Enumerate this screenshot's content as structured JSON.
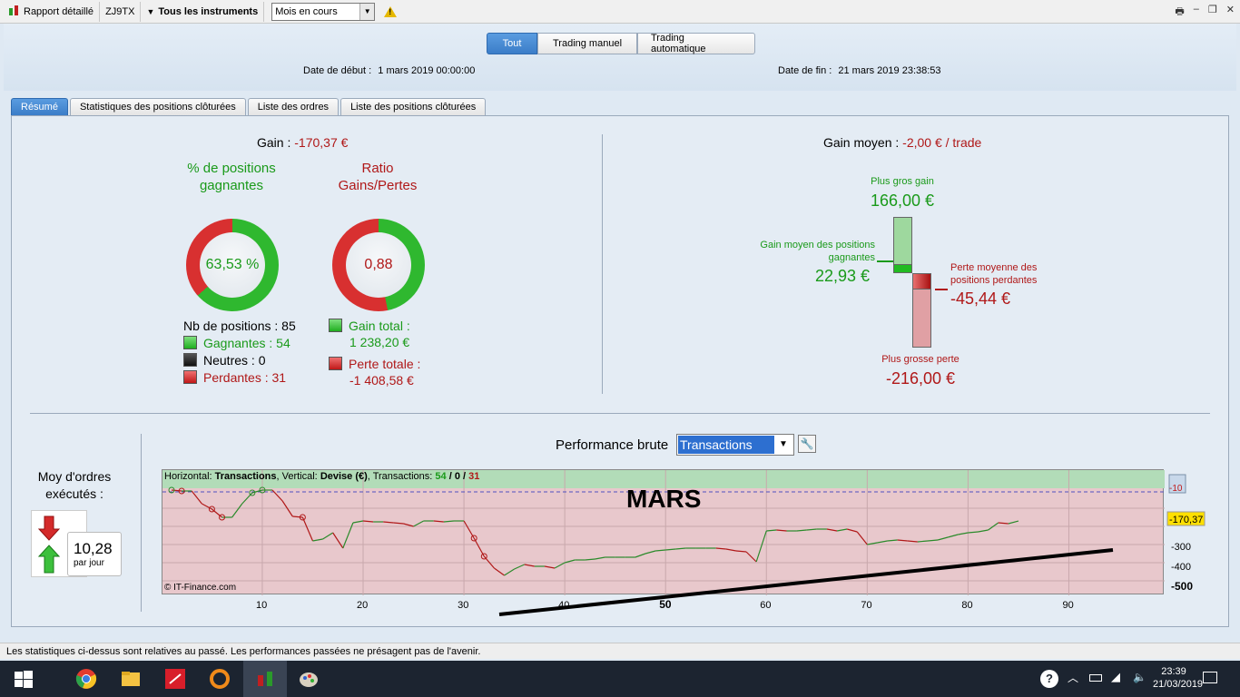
{
  "toolbar": {
    "report_label": "Rapport détaillé",
    "account": "ZJ9TX",
    "instruments": "Tous les instruments",
    "period_select": "Mois en cours"
  },
  "header": {
    "mode_tabs": [
      "Tout",
      "Trading manuel",
      "Trading automatique"
    ],
    "start_label": "Date de début :",
    "start_value": "1 mars 2019 00:00:00",
    "end_label": "Date de fin :",
    "end_value": "21 mars 2019 23:38:53"
  },
  "tabs": [
    "Résumé",
    "Statistiques des positions clôturées",
    "Liste des ordres",
    "Liste des positions clôturées"
  ],
  "summary": {
    "gain_label": "Gain :",
    "gain_value": "-170,37 €",
    "win_pct_title": "% de positions gagnantes",
    "win_pct_value": "63,53 %",
    "ratio_title": "Ratio Gains/Pertes",
    "ratio_value": "0,88",
    "nb_positions": "Nb de positions : 85",
    "winners": "Gagnantes : 54",
    "neutral": "Neutres : 0",
    "losers": "Perdantes : 31",
    "total_gain_label": "Gain total :",
    "total_gain_value": "1 238,20 €",
    "total_loss_label": "Perte totale :",
    "total_loss_value": "-1 408,58 €",
    "win_fraction": 0.6353,
    "ratio_fraction": 0.468
  },
  "avg_gain": {
    "label": "Gain moyen :",
    "value": "-2,00 € / trade",
    "biggest_gain_label": "Plus gros gain",
    "biggest_gain_value": "166,00 €",
    "avg_win_label": "Gain moyen des positions gagnantes",
    "avg_win_value": "22,93 €",
    "avg_loss_label": "Perte moyenne des positions perdantes",
    "avg_loss_value": "-45,44 €",
    "biggest_loss_label": "Plus grosse perte",
    "biggest_loss_value": "-216,00 €"
  },
  "orders": {
    "title": "Moy d'ordres exécutés :",
    "value": "10,28",
    "unit": "par jour"
  },
  "performance": {
    "title": "Performance brute",
    "select": "Transactions",
    "info_h_label": "Horizontal:",
    "info_h_value": "Transactions",
    "info_v_label": ", Vertical:",
    "info_v_value": "Devise (€)",
    "info_t_label": ", Transactions:",
    "info_win": "54",
    "info_sep1": " / ",
    "info_neutral": "0",
    "info_sep2": " / ",
    "info_loss": "31",
    "annotation": "MARS",
    "watermark": "© IT-Finance.com",
    "current_value": "-170,37",
    "ref_value": "-10"
  },
  "chart_data": {
    "type": "line",
    "x": [
      1,
      2,
      3,
      4,
      5,
      6,
      7,
      8,
      9,
      10,
      11,
      12,
      13,
      14,
      15,
      16,
      17,
      18,
      19,
      20,
      21,
      22,
      23,
      24,
      25,
      26,
      27,
      28,
      29,
      30,
      31,
      32,
      33,
      34,
      35,
      36,
      37,
      38,
      39,
      40,
      41,
      42,
      43,
      44,
      45,
      46,
      47,
      48,
      49,
      50,
      51,
      52,
      53,
      54,
      55,
      56,
      57,
      58,
      59,
      60,
      61,
      62,
      63,
      64,
      65,
      66,
      67,
      68,
      69,
      70,
      71,
      72,
      73,
      74,
      75,
      76,
      77,
      78,
      79,
      80,
      81,
      82,
      83,
      84,
      85
    ],
    "y": [
      0,
      -5,
      -5,
      -75,
      -105,
      -150,
      -150,
      -75,
      -15,
      0,
      0,
      -60,
      -145,
      -150,
      -280,
      -270,
      -235,
      -320,
      -180,
      -170,
      -175,
      -175,
      -180,
      -185,
      -200,
      -170,
      -170,
      -175,
      -170,
      -170,
      -265,
      -365,
      -430,
      -470,
      -435,
      -410,
      -420,
      -420,
      -430,
      -400,
      -385,
      -385,
      -380,
      -370,
      -370,
      -370,
      -370,
      -350,
      -335,
      -330,
      -325,
      -320,
      -320,
      -320,
      -320,
      -325,
      -335,
      -340,
      -395,
      -225,
      -220,
      -225,
      -225,
      -220,
      -215,
      -215,
      -225,
      -215,
      -230,
      -300,
      -290,
      -280,
      -275,
      -280,
      -285,
      -280,
      -275,
      -260,
      -245,
      -235,
      -230,
      -220,
      -180,
      -185,
      -170.37
    ],
    "xlabel": "Transactions",
    "ylabel": "Devise (€)",
    "x_ticks": [
      "10",
      "20",
      "30",
      "40",
      "50",
      "60",
      "70",
      "80",
      "90"
    ],
    "y_ticks": [
      "-10",
      "-200",
      "-300",
      "-400",
      "-500"
    ],
    "xlim": [
      1,
      95
    ],
    "ylim": [
      -520,
      20
    ],
    "grid": true
  }
}
